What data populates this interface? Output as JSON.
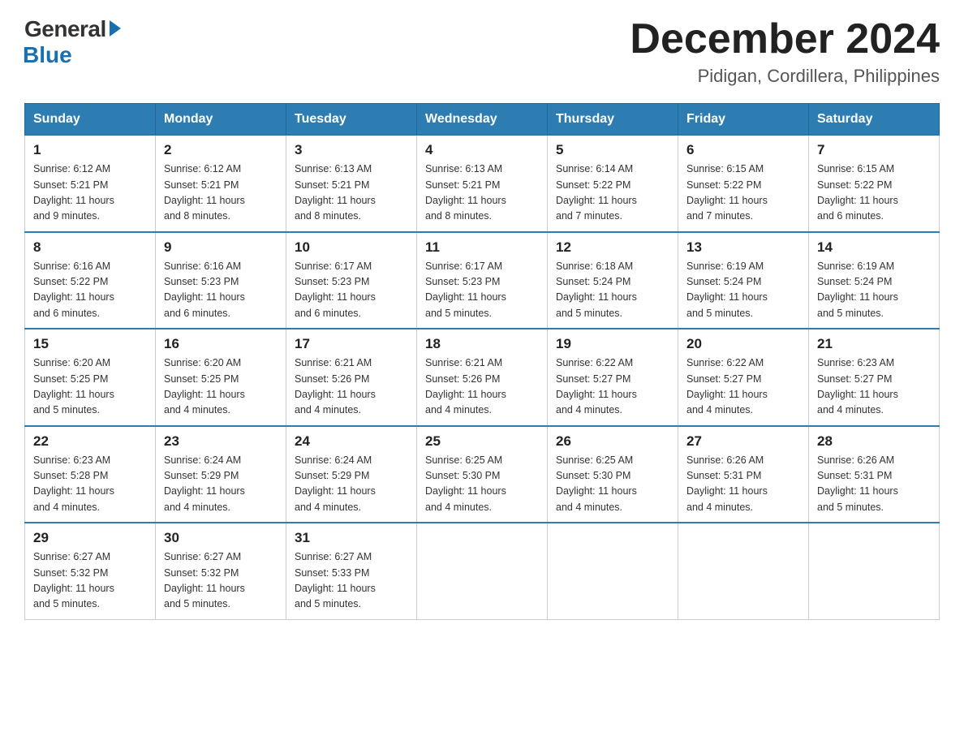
{
  "logo": {
    "general": "General",
    "blue": "Blue"
  },
  "title": "December 2024",
  "subtitle": "Pidigan, Cordillera, Philippines",
  "weekdays": [
    "Sunday",
    "Monday",
    "Tuesday",
    "Wednesday",
    "Thursday",
    "Friday",
    "Saturday"
  ],
  "weeks": [
    [
      {
        "num": "1",
        "sunrise": "6:12 AM",
        "sunset": "5:21 PM",
        "daylight": "11 hours and 9 minutes."
      },
      {
        "num": "2",
        "sunrise": "6:12 AM",
        "sunset": "5:21 PM",
        "daylight": "11 hours and 8 minutes."
      },
      {
        "num": "3",
        "sunrise": "6:13 AM",
        "sunset": "5:21 PM",
        "daylight": "11 hours and 8 minutes."
      },
      {
        "num": "4",
        "sunrise": "6:13 AM",
        "sunset": "5:21 PM",
        "daylight": "11 hours and 8 minutes."
      },
      {
        "num": "5",
        "sunrise": "6:14 AM",
        "sunset": "5:22 PM",
        "daylight": "11 hours and 7 minutes."
      },
      {
        "num": "6",
        "sunrise": "6:15 AM",
        "sunset": "5:22 PM",
        "daylight": "11 hours and 7 minutes."
      },
      {
        "num": "7",
        "sunrise": "6:15 AM",
        "sunset": "5:22 PM",
        "daylight": "11 hours and 6 minutes."
      }
    ],
    [
      {
        "num": "8",
        "sunrise": "6:16 AM",
        "sunset": "5:22 PM",
        "daylight": "11 hours and 6 minutes."
      },
      {
        "num": "9",
        "sunrise": "6:16 AM",
        "sunset": "5:23 PM",
        "daylight": "11 hours and 6 minutes."
      },
      {
        "num": "10",
        "sunrise": "6:17 AM",
        "sunset": "5:23 PM",
        "daylight": "11 hours and 6 minutes."
      },
      {
        "num": "11",
        "sunrise": "6:17 AM",
        "sunset": "5:23 PM",
        "daylight": "11 hours and 5 minutes."
      },
      {
        "num": "12",
        "sunrise": "6:18 AM",
        "sunset": "5:24 PM",
        "daylight": "11 hours and 5 minutes."
      },
      {
        "num": "13",
        "sunrise": "6:19 AM",
        "sunset": "5:24 PM",
        "daylight": "11 hours and 5 minutes."
      },
      {
        "num": "14",
        "sunrise": "6:19 AM",
        "sunset": "5:24 PM",
        "daylight": "11 hours and 5 minutes."
      }
    ],
    [
      {
        "num": "15",
        "sunrise": "6:20 AM",
        "sunset": "5:25 PM",
        "daylight": "11 hours and 5 minutes."
      },
      {
        "num": "16",
        "sunrise": "6:20 AM",
        "sunset": "5:25 PM",
        "daylight": "11 hours and 4 minutes."
      },
      {
        "num": "17",
        "sunrise": "6:21 AM",
        "sunset": "5:26 PM",
        "daylight": "11 hours and 4 minutes."
      },
      {
        "num": "18",
        "sunrise": "6:21 AM",
        "sunset": "5:26 PM",
        "daylight": "11 hours and 4 minutes."
      },
      {
        "num": "19",
        "sunrise": "6:22 AM",
        "sunset": "5:27 PM",
        "daylight": "11 hours and 4 minutes."
      },
      {
        "num": "20",
        "sunrise": "6:22 AM",
        "sunset": "5:27 PM",
        "daylight": "11 hours and 4 minutes."
      },
      {
        "num": "21",
        "sunrise": "6:23 AM",
        "sunset": "5:27 PM",
        "daylight": "11 hours and 4 minutes."
      }
    ],
    [
      {
        "num": "22",
        "sunrise": "6:23 AM",
        "sunset": "5:28 PM",
        "daylight": "11 hours and 4 minutes."
      },
      {
        "num": "23",
        "sunrise": "6:24 AM",
        "sunset": "5:29 PM",
        "daylight": "11 hours and 4 minutes."
      },
      {
        "num": "24",
        "sunrise": "6:24 AM",
        "sunset": "5:29 PM",
        "daylight": "11 hours and 4 minutes."
      },
      {
        "num": "25",
        "sunrise": "6:25 AM",
        "sunset": "5:30 PM",
        "daylight": "11 hours and 4 minutes."
      },
      {
        "num": "26",
        "sunrise": "6:25 AM",
        "sunset": "5:30 PM",
        "daylight": "11 hours and 4 minutes."
      },
      {
        "num": "27",
        "sunrise": "6:26 AM",
        "sunset": "5:31 PM",
        "daylight": "11 hours and 4 minutes."
      },
      {
        "num": "28",
        "sunrise": "6:26 AM",
        "sunset": "5:31 PM",
        "daylight": "11 hours and 5 minutes."
      }
    ],
    [
      {
        "num": "29",
        "sunrise": "6:27 AM",
        "sunset": "5:32 PM",
        "daylight": "11 hours and 5 minutes."
      },
      {
        "num": "30",
        "sunrise": "6:27 AM",
        "sunset": "5:32 PM",
        "daylight": "11 hours and 5 minutes."
      },
      {
        "num": "31",
        "sunrise": "6:27 AM",
        "sunset": "5:33 PM",
        "daylight": "11 hours and 5 minutes."
      },
      null,
      null,
      null,
      null
    ]
  ],
  "labels": {
    "sunrise": "Sunrise:",
    "sunset": "Sunset:",
    "daylight": "Daylight:"
  }
}
